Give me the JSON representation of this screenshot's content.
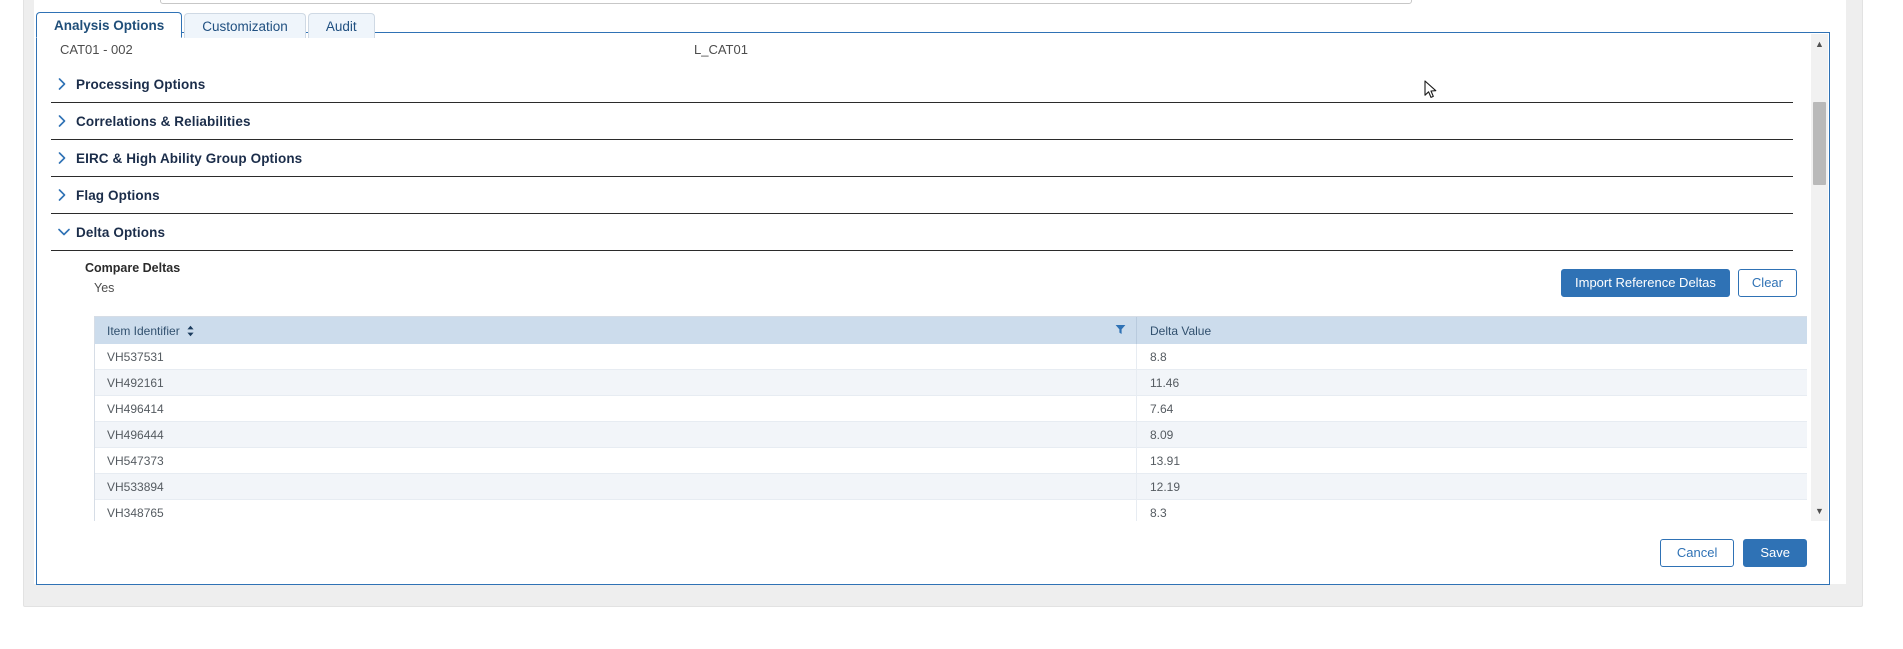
{
  "tabs": [
    {
      "label": "Analysis Options",
      "active": true
    },
    {
      "label": "Customization",
      "active": false
    },
    {
      "label": "Audit",
      "active": false
    }
  ],
  "identification": {
    "left": "CAT01 - 002",
    "right": "L_CAT01"
  },
  "sections": [
    {
      "title": "Processing Options",
      "expanded": false,
      "icon": "chevron-right-icon"
    },
    {
      "title": "Correlations & Reliabilities",
      "expanded": false,
      "icon": "chevron-right-icon"
    },
    {
      "title": "EIRC & High Ability Group Options",
      "expanded": false,
      "icon": "chevron-right-icon"
    },
    {
      "title": "Flag Options",
      "expanded": false,
      "icon": "chevron-right-icon"
    },
    {
      "title": "Delta Options",
      "expanded": true,
      "icon": "chevron-down-icon"
    }
  ],
  "delta_options": {
    "compare_deltas_label": "Compare Deltas",
    "compare_deltas_value": "Yes",
    "import_button": "Import Reference Deltas",
    "clear_button": "Clear",
    "table": {
      "columns": [
        {
          "label": "Item Identifier",
          "sortable": true,
          "filterable": true
        },
        {
          "label": "Delta Value",
          "sortable": false,
          "filterable": false
        }
      ],
      "rows": [
        {
          "item_identifier": "VH537531",
          "delta_value": "8.8"
        },
        {
          "item_identifier": "VH492161",
          "delta_value": "11.46"
        },
        {
          "item_identifier": "VH496414",
          "delta_value": "7.64"
        },
        {
          "item_identifier": "VH496444",
          "delta_value": "8.09"
        },
        {
          "item_identifier": "VH547373",
          "delta_value": "13.91"
        },
        {
          "item_identifier": "VH533894",
          "delta_value": "12.19"
        },
        {
          "item_identifier": "VH348765",
          "delta_value": "8.3"
        }
      ]
    }
  },
  "footer": {
    "cancel_label": "Cancel",
    "save_label": "Save"
  },
  "colors": {
    "accent": "#2f72b5",
    "header_row": "#ccdcec",
    "alt_row": "#f2f5f9",
    "section_title": "#1b2d4a"
  }
}
